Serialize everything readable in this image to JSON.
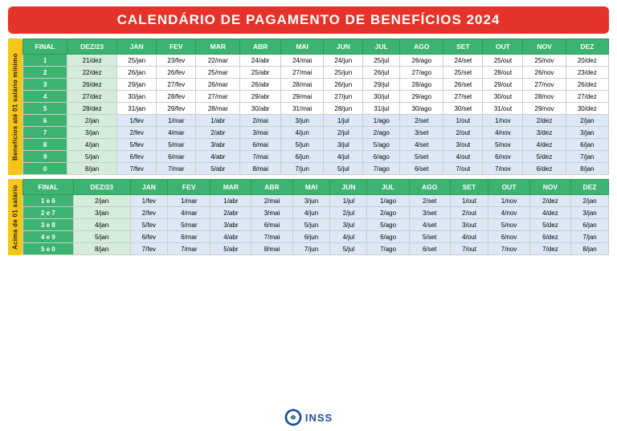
{
  "header": {
    "title": "CALENDÁRIO DE PAGAMENTO DE BENEFÍCIOS 2024"
  },
  "section1": {
    "label": "Benefícios até 01 salário mínimo",
    "headers": [
      "FINAL",
      "DEZ/23",
      "JAN",
      "FEV",
      "MAR",
      "ABR",
      "MAI",
      "JUN",
      "JUL",
      "AGO",
      "SET",
      "OUT",
      "NOV",
      "DEZ"
    ],
    "rows": [
      [
        "1",
        "21/dez",
        "25/jan",
        "23/fev",
        "22/mar",
        "24/abr",
        "24/mai",
        "24/jun",
        "25/jul",
        "26/ago",
        "24/set",
        "25/out",
        "25/nov",
        "20/dez"
      ],
      [
        "2",
        "22/dez",
        "26/jan",
        "26/fev",
        "25/mar",
        "25/abr",
        "27/mai",
        "25/jun",
        "26/jul",
        "27/ago",
        "25/set",
        "28/out",
        "26/nov",
        "23/dez"
      ],
      [
        "3",
        "26/dez",
        "29/jan",
        "27/fev",
        "26/mar",
        "26/abr",
        "28/mai",
        "26/jun",
        "29/jul",
        "28/ago",
        "26/set",
        "29/out",
        "27/nov",
        "26/dez"
      ],
      [
        "4",
        "27/dez",
        "30/jan",
        "28/fev",
        "27/mar",
        "29/abr",
        "29/mai",
        "27/jun",
        "30/jul",
        "29/ago",
        "27/set",
        "30/out",
        "28/nov",
        "27/dez"
      ],
      [
        "5",
        "28/dez",
        "31/jan",
        "29/fev",
        "28/mar",
        "30/abr",
        "31/mai",
        "28/jun",
        "31/jul",
        "30/ago",
        "30/set",
        "31/out",
        "29/nov",
        "30/dez"
      ],
      [
        "6",
        "2/jan",
        "1/fev",
        "1/mar",
        "1/abr",
        "2/mai",
        "3/jun",
        "1/jul",
        "1/ago",
        "2/set",
        "1/out",
        "1/nov",
        "2/dez",
        "2/jan"
      ],
      [
        "7",
        "3/jan",
        "2/fev",
        "4/mar",
        "2/abr",
        "3/mai",
        "4/jun",
        "2/jul",
        "2/ago",
        "3/set",
        "2/out",
        "4/nov",
        "3/dez",
        "3/jan"
      ],
      [
        "8",
        "4/jan",
        "5/fev",
        "5/mar",
        "3/abr",
        "6/mai",
        "5/jun",
        "3/jul",
        "5/ago",
        "4/set",
        "3/out",
        "5/nov",
        "4/dez",
        "6/jan"
      ],
      [
        "9",
        "5/jan",
        "6/fev",
        "6/mar",
        "4/abr",
        "7/mai",
        "6/jun",
        "4/jul",
        "6/ago",
        "5/set",
        "4/out",
        "6/nov",
        "5/dez",
        "7/jan"
      ],
      [
        "0",
        "8/jan",
        "7/fev",
        "7/mar",
        "5/abr",
        "8/mai",
        "7/jun",
        "5/jul",
        "7/ago",
        "6/set",
        "7/out",
        "7/nov",
        "6/dez",
        "8/jan"
      ]
    ]
  },
  "section2": {
    "label": "Acima de 01 salário",
    "headers": [
      "FINAL",
      "DEZ/23",
      "JAN",
      "FEV",
      "MAR",
      "ABR",
      "MAI",
      "JUN",
      "JUL",
      "AGO",
      "SET",
      "OUT",
      "NOV",
      "DEZ"
    ],
    "rows": [
      [
        "1 e 6",
        "2/jan",
        "1/fev",
        "1/mar",
        "1/abr",
        "2/mai",
        "3/jun",
        "1/jul",
        "1/ago",
        "2/set",
        "1/out",
        "1/nov",
        "2/dez",
        "2/jan"
      ],
      [
        "2 e 7",
        "3/jan",
        "2/fev",
        "4/mar",
        "2/abr",
        "3/mai",
        "4/jun",
        "2/jul",
        "2/ago",
        "3/set",
        "2/out",
        "4/nov",
        "4/dez",
        "3/jan"
      ],
      [
        "3 e 8",
        "4/jan",
        "5/fev",
        "5/mar",
        "3/abr",
        "6/mai",
        "5/jun",
        "3/jul",
        "5/ago",
        "4/set",
        "3/out",
        "5/nov",
        "5/dez",
        "6/jan"
      ],
      [
        "4 e 9",
        "5/jan",
        "6/fev",
        "6/mar",
        "4/abr",
        "7/mai",
        "6/jun",
        "4/jul",
        "6/ago",
        "5/set",
        "4/out",
        "6/nov",
        "6/dez",
        "7/jan"
      ],
      [
        "5 e 0",
        "8/jan",
        "7/fev",
        "7/mar",
        "5/abr",
        "8/mai",
        "7/jun",
        "5/jul",
        "7/ago",
        "6/set",
        "7/out",
        "7/nov",
        "7/dez",
        "8/jan"
      ]
    ]
  },
  "footer": {
    "logo_text": "INSS"
  }
}
